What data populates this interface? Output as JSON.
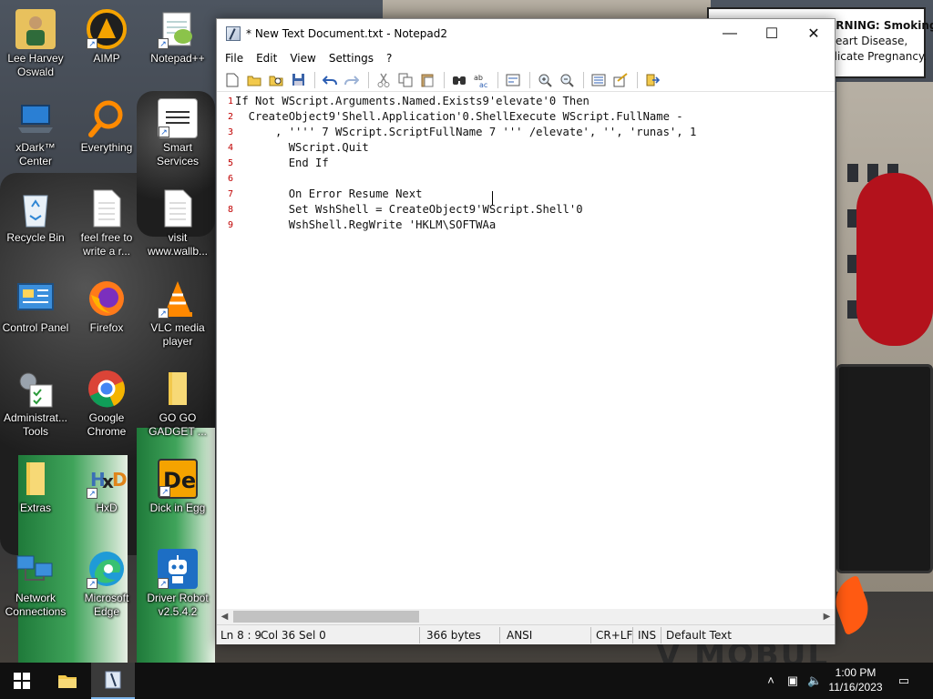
{
  "desktop": {
    "icons": [
      {
        "label": "Lee Harvey Oswald",
        "icon": "user-photo-icon",
        "shortcut": false
      },
      {
        "label": "AIMP",
        "icon": "aimp-icon",
        "shortcut": true
      },
      {
        "label": "Notepad++",
        "icon": "notepadpp-icon",
        "shortcut": true
      },
      {
        "label": "xDark™ Center",
        "icon": "laptop-icon",
        "shortcut": false
      },
      {
        "label": "Everything",
        "icon": "magnifier-icon",
        "shortcut": true
      },
      {
        "label": "Smart Services",
        "icon": "services-icon",
        "shortcut": true
      },
      {
        "label": "Recycle Bin",
        "icon": "recycle-bin-icon",
        "shortcut": false
      },
      {
        "label": "feel free to write a r...",
        "icon": "text-file-icon",
        "shortcut": false
      },
      {
        "label": "visit www.wallb...",
        "icon": "text-file-icon",
        "shortcut": false
      },
      {
        "label": "Control Panel",
        "icon": "control-panel-icon",
        "shortcut": false
      },
      {
        "label": "Firefox",
        "icon": "firefox-icon",
        "shortcut": false
      },
      {
        "label": "VLC media player",
        "icon": "vlc-icon",
        "shortcut": true
      },
      {
        "label": "Administrat... Tools",
        "icon": "admin-tools-icon",
        "shortcut": false
      },
      {
        "label": "Google Chrome",
        "icon": "chrome-icon",
        "shortcut": false
      },
      {
        "label": "GO GO GADGET ...",
        "icon": "folder-icon",
        "shortcut": false
      },
      {
        "label": "Extras",
        "icon": "folder-icon",
        "shortcut": false
      },
      {
        "label": "HxD",
        "icon": "hxd-icon",
        "shortcut": true
      },
      {
        "label": "Dick in Egg",
        "icon": "de-icon",
        "shortcut": true
      },
      {
        "label": "Network Connections",
        "icon": "network-icon",
        "shortcut": false
      },
      {
        "label": "Microsoft Edge",
        "icon": "edge-icon",
        "shortcut": true
      },
      {
        "label": "Driver Robot v2.5.4.2",
        "icon": "robot-icon",
        "shortcut": true
      }
    ],
    "sign_lines": [
      "ARNING: Smoking",
      "Heart Disease,",
      "plicate Pregnancy."
    ]
  },
  "window": {
    "title": "* New Text Document.txt - Notepad2",
    "minimize": "—",
    "maximize": "☐",
    "close": "✕"
  },
  "menu": [
    "File",
    "Edit",
    "View",
    "Settings",
    "?"
  ],
  "toolbar": [
    "new-icon",
    "open-icon",
    "browse-icon",
    "save-icon",
    "undo-icon",
    "redo-icon",
    "cut-icon",
    "copy-icon",
    "paste-icon",
    "find-icon",
    "replace-icon",
    "wordwrap-icon",
    "zoom-in-icon",
    "zoom-out-icon",
    "scheme-icon",
    "customize-icon",
    "exit-icon"
  ],
  "editor": {
    "lines": [
      {
        "n": "1",
        "text": "If Not WScript.Arguments.Named.Exists9'elevate'0 Then"
      },
      {
        "n": "2",
        "text": "  CreateObject9'Shell.Application'0.ShellExecute WScript.FullName -"
      },
      {
        "n": "3",
        "text": "      , '''' 7 WScript.ScriptFullName 7 ''' /elevate', '', 'runas', 1"
      },
      {
        "n": "4",
        "text": "        WScript.Quit"
      },
      {
        "n": "5",
        "text": "        End If"
      },
      {
        "n": "6",
        "text": ""
      },
      {
        "n": "7",
        "text": "        On Error Resume Next"
      },
      {
        "n": "8",
        "text": "        Set WshShell = CreateObject9'WScript.Shell'0"
      },
      {
        "n": "9",
        "text": "        WshShell.RegWrite 'HKLM\\SOFTWAa"
      }
    ]
  },
  "status": {
    "position": "Ln 8 : 9",
    "column": "Col 36",
    "selection": "Sel 0",
    "size": "366 bytes",
    "encoding": "ANSI",
    "eol": "CR+LF",
    "mode": "INS",
    "style": "Default Text"
  },
  "taskbar": {
    "time": "1:00 PM",
    "date": "11/16/2023"
  }
}
